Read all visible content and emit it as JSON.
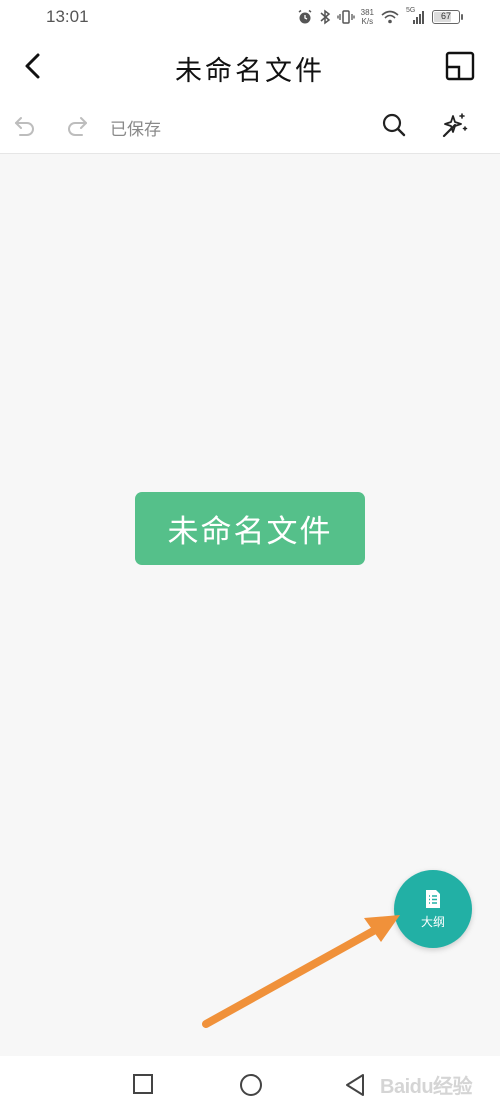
{
  "status_bar": {
    "time": "13:01",
    "net_speed_value": "381",
    "net_speed_unit": "K/s",
    "network": "5G",
    "battery": "67"
  },
  "header": {
    "title": "未命名文件",
    "back_icon": "chevron-left-icon",
    "layout_icon": "layout-icon"
  },
  "toolbar": {
    "saved_label": "已保存",
    "undo_icon": "undo-icon",
    "redo_icon": "redo-icon",
    "search_icon": "search-icon",
    "theme_icon": "magic-wand-icon"
  },
  "canvas": {
    "root_node_text": "未命名文件",
    "root_node_color": "#55c08a",
    "background": "#f7f7f7"
  },
  "outline_fab": {
    "label": "大纲",
    "color": "#22b0a5",
    "icon": "document-list-icon"
  },
  "annotation": {
    "arrow_color": "#f0913a"
  },
  "nav_bar": {
    "recent_icon": "square-icon",
    "home_icon": "circle-icon",
    "back_icon": "triangle-back-icon"
  },
  "watermark": {
    "text": "Baidu经验"
  }
}
